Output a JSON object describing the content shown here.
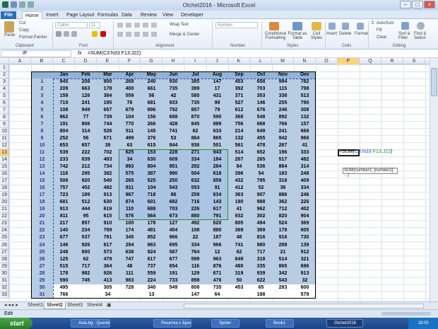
{
  "window": {
    "title": "Otchet2016 - Microsoft Excel"
  },
  "tabs": [
    "File",
    "Home",
    "Insert",
    "Page Layout",
    "Formulas",
    "Data",
    "Review",
    "View",
    "Developer"
  ],
  "ribbon": {
    "clipboard": {
      "paste": "Paste",
      "cut": "Cut",
      "copy": "Copy",
      "format_painter": "Format Painter",
      "label": "Clipboard"
    },
    "font": {
      "name": "Calibri",
      "size": "11",
      "label": "Font"
    },
    "alignment": {
      "wrap": "Wrap Text",
      "merge": "Merge & Center",
      "label": "Alignment"
    },
    "number": {
      "format": "Number",
      "label": "Number"
    },
    "styles": {
      "conditional": "Conditional Formatting",
      "format_table": "Format as Table",
      "cell_styles": "Cell Styles",
      "label": "Styles"
    },
    "cells": {
      "insert": "Insert",
      "delete": "Delete",
      "format": "Format",
      "label": "Cells"
    },
    "editing": {
      "autosum": "AutoSum",
      "fill": "Fill",
      "clear": "Clear",
      "sort": "Sort & Filter",
      "find": "Find & Select",
      "label": "Editing"
    }
  },
  "formula_bar": {
    "name_box": "IF",
    "fx": "fx",
    "formula": "=SUM(C3:N33 F13:J22)"
  },
  "columns": [
    "A",
    "B",
    "C",
    "D",
    "E",
    "F",
    "G",
    "H",
    "I",
    "J",
    "K",
    "L",
    "M",
    "N",
    "O",
    "P",
    "Q",
    "R",
    "S"
  ],
  "month_headers": [
    "Jan",
    "Feb",
    "Mar",
    "Apr",
    "May",
    "Jun",
    "Jul",
    "Aug",
    "Sep",
    "Oct",
    "Nov",
    "Dec"
  ],
  "rows": [
    [
      "1",
      "945",
      "208",
      "900",
      "268",
      "240",
      "930",
      "385",
      "147",
      "453",
      "658",
      "994",
      "782"
    ],
    [
      "2",
      "209",
      "663",
      "178",
      "400",
      "661",
      "735",
      "399",
      "17",
      "392",
      "703",
      "115",
      "798"
    ],
    [
      "3",
      "159",
      "126",
      "384",
      "559",
      "56",
      "42",
      "580",
      "431",
      "371",
      "353",
      "338",
      "513"
    ],
    [
      "4",
      "719",
      "241",
      "195",
      "76",
      "681",
      "933",
      "735",
      "99",
      "527",
      "146",
      "255",
      "790"
    ],
    [
      "5",
      "108",
      "949",
      "657",
      "679",
      "896",
      "792",
      "857",
      "79",
      "612",
      "676",
      "246",
      "308"
    ],
    [
      "6",
      "862",
      "77",
      "739",
      "104",
      "156",
      "688",
      "870",
      "590",
      "368",
      "548",
      "892",
      "132"
    ],
    [
      "7",
      "191",
      "806",
      "744",
      "770",
      "266",
      "428",
      "845",
      "889",
      "756",
      "668",
      "766",
      "157"
    ],
    [
      "8",
      "804",
      "314",
      "526",
      "511",
      "145",
      "741",
      "62",
      "633",
      "214",
      "649",
      "241",
      "669"
    ],
    [
      "9",
      "252",
      "56",
      "671",
      "499",
      "376",
      "53",
      "864",
      "865",
      "132",
      "455",
      "942",
      "966"
    ],
    [
      "10",
      "653",
      "657",
      "38",
      "63",
      "615",
      "844",
      "936",
      "501",
      "561",
      "478",
      "267",
      "41"
    ],
    [
      "11",
      "539",
      "222",
      "702",
      "625",
      "153",
      "228",
      "271",
      "943",
      "514",
      "652",
      "196",
      "333"
    ],
    [
      "12",
      "233",
      "839",
      "493",
      "34",
      "630",
      "609",
      "334",
      "184",
      "267",
      "265",
      "517",
      "482"
    ],
    [
      "13",
      "742",
      "212",
      "734",
      "893",
      "804",
      "951",
      "292",
      "284",
      "84",
      "536",
      "864",
      "314"
    ],
    [
      "14",
      "118",
      "295",
      "382",
      "575",
      "387",
      "990",
      "504",
      "618",
      "396",
      "54",
      "183",
      "248"
    ],
    [
      "15",
      "508",
      "920",
      "540",
      "265",
      "525",
      "250",
      "632",
      "859",
      "432",
      "795",
      "318",
      "409"
    ],
    [
      "16",
      "757",
      "452",
      "492",
      "811",
      "104",
      "543",
      "553",
      "91",
      "412",
      "52",
      "36",
      "334"
    ],
    [
      "17",
      "723",
      "189",
      "913",
      "967",
      "718",
      "86",
      "259",
      "634",
      "363",
      "907",
      "886",
      "246"
    ],
    [
      "18",
      "681",
      "512",
      "630",
      "874",
      "601",
      "682",
      "716",
      "143",
      "190",
      "988",
      "362",
      "226"
    ],
    [
      "19",
      "913",
      "444",
      "619",
      "110",
      "688",
      "703",
      "226",
      "617",
      "41",
      "962",
      "712",
      "402"
    ],
    [
      "20",
      "811",
      "95",
      "615",
      "576",
      "564",
      "673",
      "880",
      "791",
      "932",
      "302",
      "820",
      "904"
    ],
    [
      "21",
      "217",
      "857",
      "910",
      "100",
      "178",
      "127",
      "492",
      "620",
      "805",
      "494",
      "524",
      "369"
    ],
    [
      "22",
      "140",
      "234",
      "769",
      "174",
      "481",
      "404",
      "108",
      "880",
      "369",
      "369",
      "178",
      "605"
    ],
    [
      "23",
      "677",
      "537",
      "791",
      "345",
      "852",
      "966",
      "22",
      "187",
      "48",
      "816",
      "916",
      "730"
    ],
    [
      "24",
      "146",
      "926",
      "617",
      "294",
      "863",
      "695",
      "334",
      "966",
      "741",
      "980",
      "289",
      "139"
    ],
    [
      "25",
      "248",
      "600",
      "573",
      "638",
      "924",
      "567",
      "764",
      "12",
      "62",
      "717",
      "21",
      "912"
    ],
    [
      "26",
      "125",
      "62",
      "479",
      "747",
      "617",
      "677",
      "599",
      "963",
      "649",
      "318",
      "514",
      "321"
    ],
    [
      "27",
      "515",
      "717",
      "364",
      "48",
      "737",
      "654",
      "116",
      "876",
      "480",
      "335",
      "865",
      "696"
    ],
    [
      "28",
      "178",
      "982",
      "926",
      "111",
      "559",
      "191",
      "129",
      "671",
      "319",
      "939",
      "342",
      "913"
    ],
    [
      "29",
      "590",
      "745",
      "413",
      "983",
      "224",
      "733",
      "898",
      "476",
      "50",
      "622",
      "543",
      "32"
    ],
    [
      "30",
      "495",
      "",
      "305",
      "728",
      "340",
      "549",
      "808",
      "735",
      "453",
      "65",
      "283",
      "600"
    ],
    [
      "31",
      "766",
      "",
      "34",
      "",
      "13",
      "",
      "147",
      "64",
      "",
      "188",
      "",
      "579"
    ]
  ],
  "edit_text": {
    "prefix": "=SUM(",
    "range1": "C3:N33",
    "space": " ",
    "range2": "F13:J22",
    "suffix": ")"
  },
  "tooltip": "SUM(number1; [number2]; ...)",
  "sheets": [
    "Sheet1",
    "Sheet2",
    "Sheet3",
    "Sheet4"
  ],
  "active_sheet": "Sheet2",
  "status": {
    "mode": "Edit"
  },
  "taskbar": {
    "start": "start",
    "items": [
      "Aula.bg - Question ...",
      "Решетка с Бросссе...",
      "Spider",
      "Book1",
      "Otchet2016"
    ],
    "time": "18:03"
  },
  "colors": {
    "table_fill": "#b8cce4",
    "header_fill": "#95b3d7",
    "selection_orange": "#f8d57e",
    "excel_green": "#1f7244",
    "accent_blue": "#2c6fb8"
  }
}
